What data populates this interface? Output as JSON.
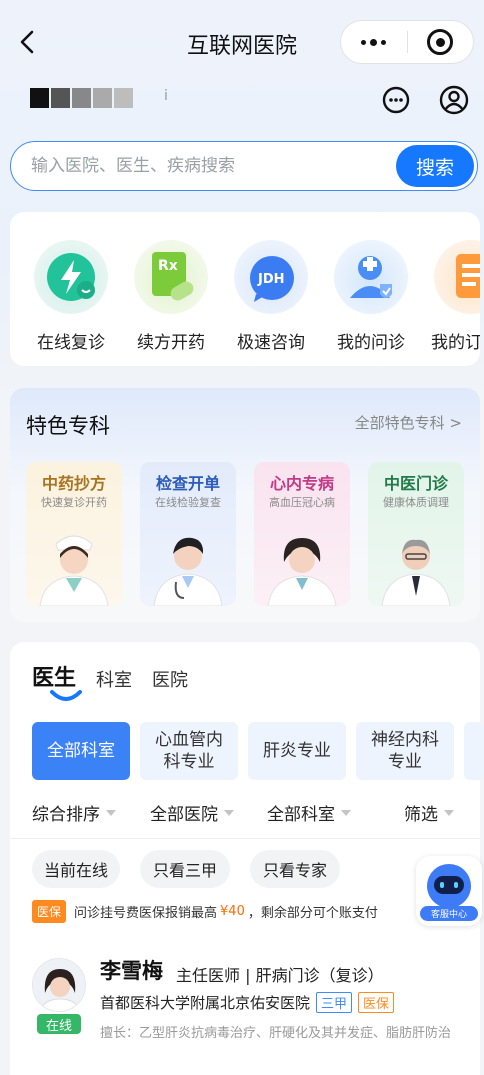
{
  "nav": {
    "title": "互联网医院",
    "back_icon": "chevron-left-icon",
    "more_icon": "more-dots-icon",
    "close_icon": "target-icon"
  },
  "header": {
    "tick": "i",
    "message_icon": "message-icon",
    "user_icon": "user-icon"
  },
  "search": {
    "placeholder": "输入医院、医生、疾病搜索",
    "button": "搜索"
  },
  "quick_entries": [
    {
      "label": "在线复诊",
      "icon": "lightning-icon"
    },
    {
      "label": "续方开药",
      "icon": "rx-pill-icon"
    },
    {
      "label": "极速咨询",
      "icon": "jdh-bubble-icon"
    },
    {
      "label": "我的问诊",
      "icon": "doctor-shield-icon"
    },
    {
      "label": "我的订",
      "icon": "document-icon"
    }
  ],
  "specialty": {
    "title": "特色专科",
    "more": "全部特色专科 >",
    "cards": [
      {
        "title": "中药抄方",
        "subtitle": "快速复诊开药"
      },
      {
        "title": "检查开单",
        "subtitle": "在线检验复查"
      },
      {
        "title": "心内专病",
        "subtitle": "高血压冠心病"
      },
      {
        "title": "中医门诊",
        "subtitle": "健康体质调理"
      }
    ]
  },
  "tabs": [
    "医生",
    "科室",
    "医院"
  ],
  "departments": [
    "全部科室",
    "心血管内科专业",
    "肝炎专业",
    "神经内科专业"
  ],
  "sort": [
    "综合排序",
    "全部医院",
    "全部科室",
    "筛选"
  ],
  "filters": [
    "当前在线",
    "只看三甲",
    "只看专家"
  ],
  "insurance": {
    "tag": "医保",
    "pre": "问诊挂号费医保报销最高",
    "amount": "¥40",
    "post": "，剩余部分可个账支付"
  },
  "service": {
    "label": "客服中心"
  },
  "doctor": {
    "name": "李雪梅",
    "title": "主任医师 | 肝病门诊（复诊）",
    "hospital": "首都医科大学附属北京佑安医院",
    "level": "三甲",
    "badge": "医保",
    "status": "在线",
    "skill": "擅长：乙型肝炎抗病毒治疗、肝硬化及其并发症、脂肪肝防治"
  },
  "colors": {
    "accent": "#1677ff",
    "orange": "#ff8a1f",
    "online": "#34b868"
  }
}
